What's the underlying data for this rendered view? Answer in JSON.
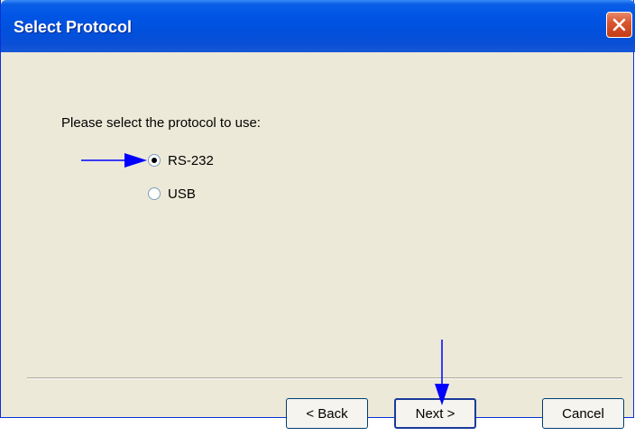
{
  "window": {
    "title": "Select Protocol"
  },
  "content": {
    "prompt": "Please select the protocol to use:",
    "options": [
      {
        "label": "RS-232",
        "selected": true
      },
      {
        "label": "USB",
        "selected": false
      }
    ]
  },
  "buttons": {
    "back": "< Back",
    "next": "Next >",
    "cancel": "Cancel"
  },
  "colors": {
    "titlebar": "#0055e5",
    "dialog_bg": "#ece9d8",
    "annotation_arrow": "#0000ff",
    "close_button": "#d9572f"
  },
  "icons": {
    "close": "close-icon",
    "annotation": "arrow-icon"
  }
}
